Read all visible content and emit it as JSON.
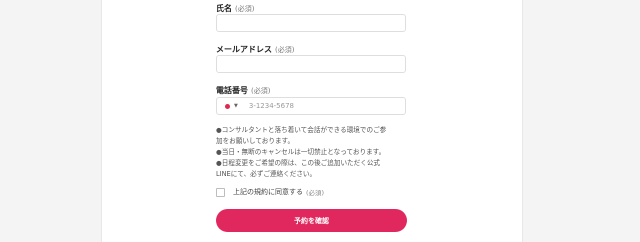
{
  "form": {
    "name_field": {
      "label": "氏名",
      "required": "(必須)",
      "value": ""
    },
    "email_field": {
      "label": "メールアドレス",
      "required": "(必須)",
      "value": ""
    },
    "phone_field": {
      "label": "電話番号",
      "required": "(必須)",
      "country_flag": "jp-flag-icon",
      "placeholder": "3-1234-5678"
    },
    "notes": [
      "●コンサルタントと落ち着いて会話ができる環境でのご参",
      "加をお願いしております。",
      "●当日・無断のキャンセルは一切禁止となっております。",
      "●日程変更をご希望の際は、この後ご追加いただく公式",
      "LINEにて、必ずご連絡ください。"
    ],
    "agreement": {
      "label": "上記の規約に同意する",
      "required": "(必須)",
      "checked": false
    },
    "submit_label": "予約を確認"
  },
  "colors": {
    "accent": "#e0285e",
    "flag_red": "#e0284f"
  }
}
